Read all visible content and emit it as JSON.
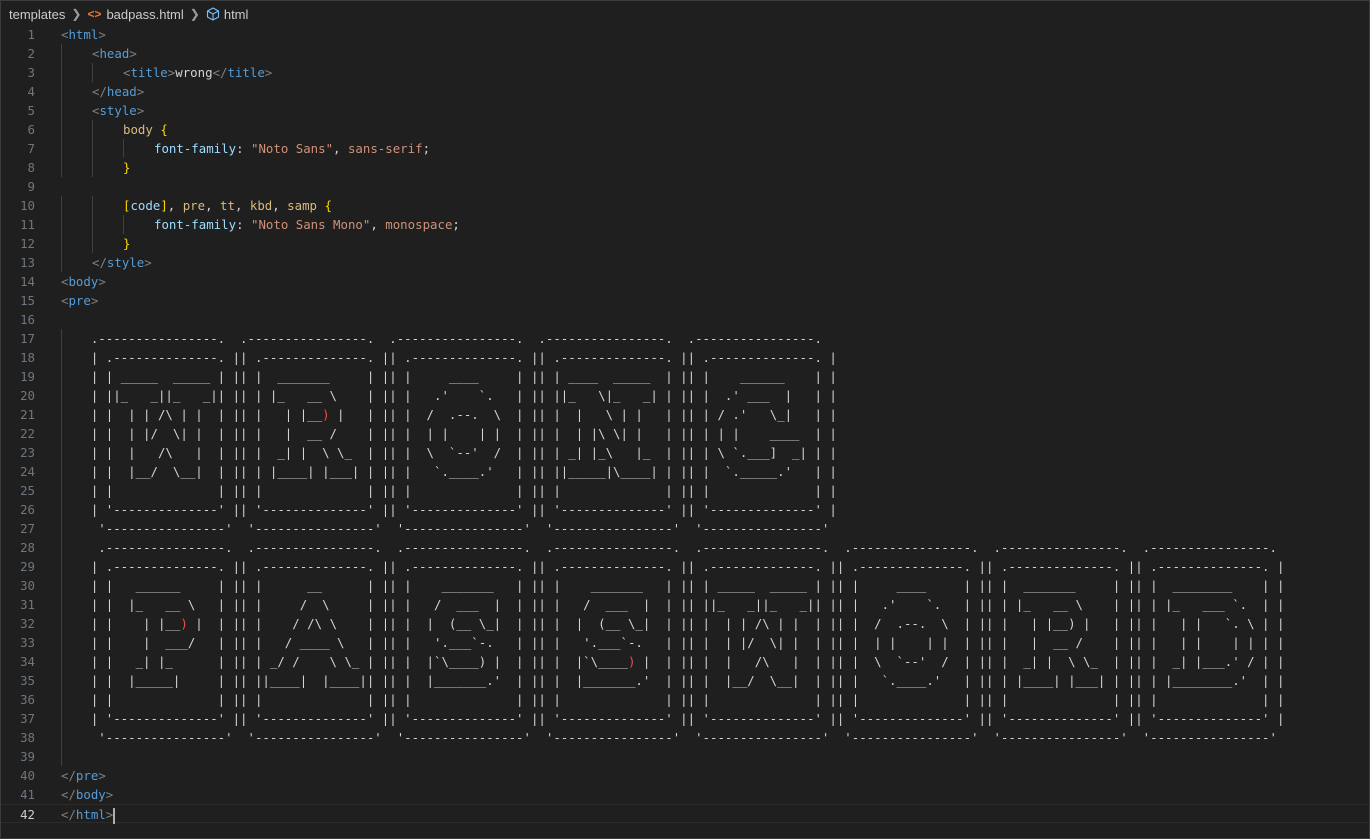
{
  "breadcrumb": {
    "folder": "templates",
    "file": "badpass.html",
    "symbol": "html"
  },
  "lines": [
    {
      "n": 1,
      "indent": 0,
      "tokens": [
        [
          "punc",
          "<"
        ],
        [
          "tag",
          "html"
        ],
        [
          "punc",
          ">"
        ]
      ]
    },
    {
      "n": 2,
      "indent": 1,
      "tokens": [
        [
          "punc",
          "<"
        ],
        [
          "tag",
          "head"
        ],
        [
          "punc",
          ">"
        ]
      ]
    },
    {
      "n": 3,
      "indent": 2,
      "tokens": [
        [
          "punc",
          "<"
        ],
        [
          "tag",
          "title"
        ],
        [
          "punc",
          ">"
        ],
        [
          "txt",
          "wrong"
        ],
        [
          "punc",
          "</"
        ],
        [
          "tag",
          "title"
        ],
        [
          "punc",
          ">"
        ]
      ]
    },
    {
      "n": 4,
      "indent": 1,
      "tokens": [
        [
          "punc",
          "</"
        ],
        [
          "tag",
          "head"
        ],
        [
          "punc",
          ">"
        ]
      ]
    },
    {
      "n": 5,
      "indent": 1,
      "tokens": [
        [
          "punc",
          "<"
        ],
        [
          "tag",
          "style"
        ],
        [
          "punc",
          ">"
        ]
      ]
    },
    {
      "n": 6,
      "indent": 2,
      "tokens": [
        [
          "sel",
          "body "
        ],
        [
          "brace",
          "{"
        ]
      ]
    },
    {
      "n": 7,
      "indent": 3,
      "tokens": [
        [
          "prop",
          "font-family"
        ],
        [
          "txt",
          ": "
        ],
        [
          "str",
          "\"Noto Sans\""
        ],
        [
          "txt",
          ", "
        ],
        [
          "val",
          "sans-serif"
        ],
        [
          "txt",
          ";"
        ]
      ]
    },
    {
      "n": 8,
      "indent": 2,
      "tokens": [
        [
          "brace",
          "}"
        ]
      ]
    },
    {
      "n": 9,
      "indent": 0,
      "tokens": []
    },
    {
      "n": 10,
      "indent": 2,
      "tokens": [
        [
          "brace",
          "["
        ],
        [
          "prop",
          "code"
        ],
        [
          "brace",
          "]"
        ],
        [
          "txt",
          ", "
        ],
        [
          "sel",
          "pre"
        ],
        [
          "txt",
          ", "
        ],
        [
          "sel",
          "tt"
        ],
        [
          "txt",
          ", "
        ],
        [
          "sel",
          "kbd"
        ],
        [
          "txt",
          ", "
        ],
        [
          "sel",
          "samp "
        ],
        [
          "brace",
          "{"
        ]
      ]
    },
    {
      "n": 11,
      "indent": 3,
      "tokens": [
        [
          "prop",
          "font-family"
        ],
        [
          "txt",
          ": "
        ],
        [
          "str",
          "\"Noto Sans Mono\""
        ],
        [
          "txt",
          ", "
        ],
        [
          "val",
          "monospace"
        ],
        [
          "txt",
          ";"
        ]
      ]
    },
    {
      "n": 12,
      "indent": 2,
      "tokens": [
        [
          "brace",
          "}"
        ]
      ]
    },
    {
      "n": 13,
      "indent": 1,
      "tokens": [
        [
          "punc",
          "</"
        ],
        [
          "tag",
          "style"
        ],
        [
          "punc",
          ">"
        ]
      ]
    },
    {
      "n": 14,
      "indent": 0,
      "tokens": [
        [
          "punc",
          "<"
        ],
        [
          "tag",
          "body"
        ],
        [
          "punc",
          ">"
        ]
      ]
    },
    {
      "n": 15,
      "indent": 0,
      "tokens": [
        [
          "punc",
          "<"
        ],
        [
          "tag",
          "pre"
        ],
        [
          "punc",
          ">"
        ]
      ]
    },
    {
      "n": 16,
      "indent": 0,
      "tokens": []
    },
    {
      "n": 17,
      "indent": 0,
      "tokens": [
        [
          "art",
          "    .----------------.  .----------------.  .----------------.  .----------------.  .----------------."
        ]
      ]
    },
    {
      "n": 18,
      "indent": 0,
      "tokens": [
        [
          "art",
          "    | .--------------. || .--------------. || .--------------. || .--------------. || .--------------. |"
        ]
      ]
    },
    {
      "n": 19,
      "indent": 0,
      "tokens": [
        [
          "art",
          "    | | _____  _____ | || |  _______     | || |     ____     | || | ____  _____  | || |    ______    | |"
        ]
      ]
    },
    {
      "n": 20,
      "indent": 0,
      "tokens": [
        [
          "art",
          "    | ||_   _||_   _|| || | |_   __ \\    | || |   .'    `.   | || ||_   \\|_   _| | || |  .' ___  |   | |"
        ]
      ]
    },
    {
      "n": 21,
      "indent": 0,
      "tokens": [
        [
          "art",
          "    | |  | | /\\ | |  | || |   | |__"
        ],
        [
          "red",
          ")"
        ],
        [
          "art",
          " |   | || |  /  .--.  \\  | || |  |   \\ | |   | || | / .'   \\_|   | |"
        ]
      ]
    },
    {
      "n": 22,
      "indent": 0,
      "tokens": [
        [
          "art",
          "    | |  | |/  \\| |  | || |   |  __ /    | || |  | |    | |  | || |  | |\\ \\| |   | || | | |    ____  | |"
        ]
      ]
    },
    {
      "n": 23,
      "indent": 0,
      "tokens": [
        [
          "art",
          "    | |  |   /\\   |  | || |  _| |  \\ \\_  | || |  \\  `--'  /  | || | _| |_\\   |_  | || | \\ `.___]  _| | |"
        ]
      ]
    },
    {
      "n": 24,
      "indent": 0,
      "tokens": [
        [
          "art",
          "    | |  |__/  \\__|  | || | |____| |___| | || |   `.____.'   | || ||_____|\\____| | || |  `._____.'   | |"
        ]
      ]
    },
    {
      "n": 25,
      "indent": 0,
      "tokens": [
        [
          "art",
          "    | |              | || |              | || |              | || |              | || |              | |"
        ]
      ]
    },
    {
      "n": 26,
      "indent": 0,
      "tokens": [
        [
          "art",
          "    | '--------------' || '--------------' || '--------------' || '--------------' || '--------------' |"
        ]
      ]
    },
    {
      "n": 27,
      "indent": 0,
      "tokens": [
        [
          "art",
          "     '----------------'  '----------------'  '----------------'  '----------------'  '----------------'"
        ]
      ]
    },
    {
      "n": 28,
      "indent": 0,
      "tokens": [
        [
          "art",
          "     .----------------.  .----------------.  .----------------.  .----------------.  .----------------.  .----------------.  .----------------.  .----------------."
        ]
      ]
    },
    {
      "n": 29,
      "indent": 0,
      "tokens": [
        [
          "art",
          "    | .--------------. || .--------------. || .--------------. || .--------------. || .--------------. || .--------------. || .--------------. || .--------------. |"
        ]
      ]
    },
    {
      "n": 30,
      "indent": 0,
      "tokens": [
        [
          "art",
          "    | |   ______     | || |      __      | || |    _______   | || |    _______   | || | _____  _____ | || |     ____     | || |  _______     | || |  ________    | |"
        ]
      ]
    },
    {
      "n": 31,
      "indent": 0,
      "tokens": [
        [
          "art",
          "    | |  |_   __ \\   | || |     /  \\     | || |   /  ___  |  | || |   /  ___  |  | || ||_   _||_   _|| || |   .'    `.   | || | |_   __ \\    | || | |_   ___ `.  | |"
        ]
      ]
    },
    {
      "n": 32,
      "indent": 0,
      "tokens": [
        [
          "art",
          "    | |    | |__"
        ],
        [
          "red",
          ")"
        ],
        [
          "art",
          " |  | || |    / /\\ \\    | || |  |  (__ \\_|  | || |  |  (__ \\_|  | || |  | | /\\ | |  | || |  /  .--.  \\  | || |   | |__) |   | || |   | |   `. \\ | |"
        ]
      ]
    },
    {
      "n": 33,
      "indent": 0,
      "tokens": [
        [
          "art",
          "    | |    |  ___/   | || |   / ____ \\   | || |   '.___`-.   | || |   '.___`-.   | || |  | |/  \\| |  | || |  | |    | |  | || |   |  __ /    | || |   | |    | | | |"
        ]
      ]
    },
    {
      "n": 34,
      "indent": 0,
      "tokens": [
        [
          "art",
          "    | |   _| |_      | || | _/ /    \\ \\_ | || |  |`\\____) |  | || |  |`\\____"
        ],
        [
          "red",
          ")"
        ],
        [
          "art",
          " |  | || |  |   /\\   |  | || |  \\  `--'  /  | || |  _| |  \\ \\_  | || |  _| |___.' / | |"
        ]
      ]
    },
    {
      "n": 35,
      "indent": 0,
      "tokens": [
        [
          "art",
          "    | |  |_____|     | || ||____|  |____|| || |  |_______.'  | || |  |_______.'  | || |  |__/  \\__|  | || |   `.____.'   | || | |____| |___| | || | |________.'  | |"
        ]
      ]
    },
    {
      "n": 36,
      "indent": 0,
      "tokens": [
        [
          "art",
          "    | |              | || |              | || |              | || |              | || |              | || |              | || |              | || |              | |"
        ]
      ]
    },
    {
      "n": 37,
      "indent": 0,
      "tokens": [
        [
          "art",
          "    | '--------------' || '--------------' || '--------------' || '--------------' || '--------------' || '--------------' || '--------------' || '--------------' |"
        ]
      ]
    },
    {
      "n": 38,
      "indent": 0,
      "tokens": [
        [
          "art",
          "     '----------------'  '----------------'  '----------------'  '----------------'  '----------------'  '----------------'  '----------------'  '----------------'"
        ]
      ]
    },
    {
      "n": 39,
      "indent": 0,
      "tokens": []
    },
    {
      "n": 40,
      "indent": 0,
      "tokens": [
        [
          "punc",
          "</"
        ],
        [
          "tag",
          "pre"
        ],
        [
          "punc",
          ">"
        ]
      ]
    },
    {
      "n": 41,
      "indent": 0,
      "tokens": [
        [
          "punc",
          "</"
        ],
        [
          "tag",
          "body"
        ],
        [
          "punc",
          ">"
        ]
      ]
    },
    {
      "n": 42,
      "indent": 0,
      "tokens": [
        [
          "punc",
          "</"
        ],
        [
          "tag",
          "html"
        ],
        [
          "punc",
          ">"
        ]
      ],
      "cursor": true
    }
  ]
}
